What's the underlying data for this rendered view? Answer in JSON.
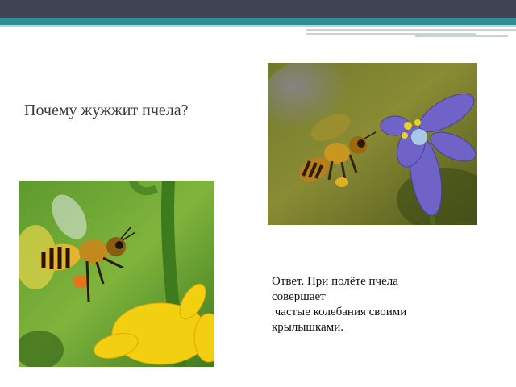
{
  "slide": {
    "title": "Почему жужжит пчела?",
    "answer_lines": [
      "Ответ. При полёте пчела",
      "совершает",
      " частые колебания своими",
      "крылышками."
    ]
  },
  "images": {
    "top_right": "bee-approaching-blue-flower-photo",
    "bottom_left": "bee-near-yellow-dandelion-photo"
  },
  "colors": {
    "header_dark": "#3f4353",
    "header_teal": "#2f8e95",
    "header_light": "#bfd3d5"
  }
}
